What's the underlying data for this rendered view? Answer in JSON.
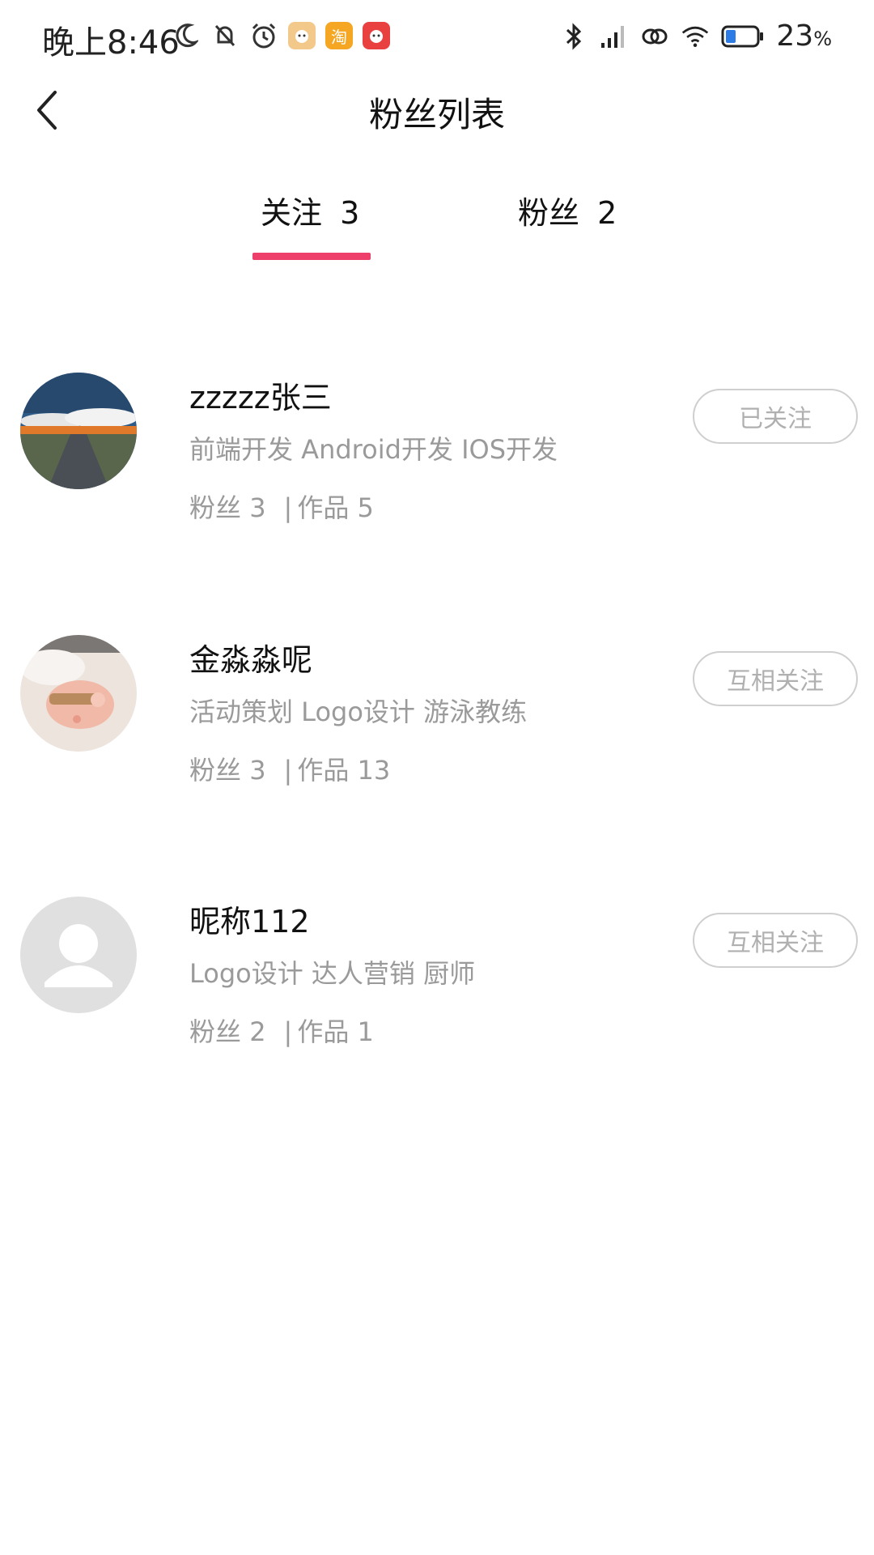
{
  "status_bar": {
    "time": "晚上8:46",
    "battery": "23",
    "battery_unit": "%",
    "left_icons": [
      "moon-icon",
      "bell-muted-icon",
      "alarm-icon",
      "app-icon-1",
      "app-icon-taobao",
      "app-icon-3"
    ],
    "taobao_glyph": "淘",
    "right_icons": [
      "bluetooth-icon",
      "signal-icon",
      "link-icon",
      "wifi-icon",
      "battery-icon"
    ]
  },
  "header": {
    "title": "粉丝列表"
  },
  "tabs": [
    {
      "label": "关注",
      "count": "3",
      "active": true
    },
    {
      "label": "粉丝",
      "count": "2",
      "active": false
    }
  ],
  "colors": {
    "accent": "#ee3e6a",
    "muted": "#9a9a9a",
    "border": "#cfcfcf"
  },
  "users": [
    {
      "name": "zzzzz张三",
      "tags": "前端开发 Android开发 IOS开发",
      "fans_label": "粉丝",
      "fans": "3",
      "works_label": "作品",
      "works": "5",
      "button": "已关注",
      "avatar": "landscape-photo"
    },
    {
      "name": "金淼淼呢",
      "tags": "活动策划 Logo设计 游泳教练",
      "fans_label": "粉丝",
      "fans": "3",
      "works_label": "作品",
      "works": "13",
      "button": "互相关注",
      "avatar": "pig-plush-photo"
    },
    {
      "name": "昵称112",
      "tags": "Logo设计 达人营销 厨师",
      "fans_label": "粉丝",
      "fans": "2",
      "works_label": "作品",
      "works": "1",
      "button": "互相关注",
      "avatar": "default-avatar"
    }
  ]
}
